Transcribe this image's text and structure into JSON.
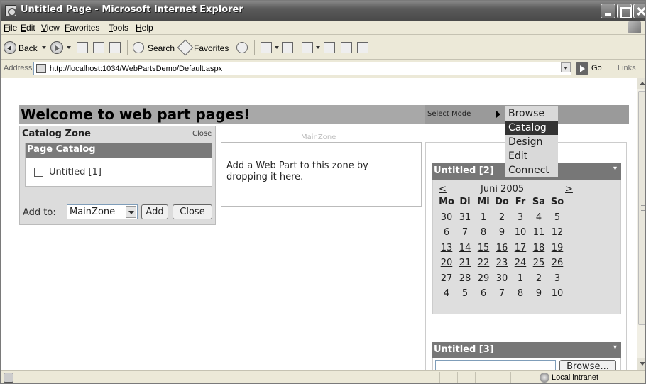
{
  "window": {
    "title": "Untitled Page - Microsoft Internet Explorer"
  },
  "menu": {
    "items": [
      "File",
      "Edit",
      "View",
      "Favorites",
      "Tools",
      "Help"
    ]
  },
  "toolbar": {
    "back_label": "Back",
    "search_label": "Search",
    "favorites_label": "Favorites"
  },
  "address": {
    "label": "Address",
    "url": "http://localhost:1034/WebPartsDemo/Default.aspx",
    "go_label": "Go",
    "links_label": "Links"
  },
  "page": {
    "heading": "Welcome to web part pages!",
    "mode": {
      "label": "Select Mode",
      "items": [
        "Browse",
        "Catalog",
        "Design",
        "Edit",
        "Connect"
      ],
      "selected": "Catalog"
    },
    "catalog_zone": {
      "title": "Catalog Zone",
      "close_verb": "Close",
      "page_catalog_title": "Page Catalog",
      "item": "Untitled [1]",
      "add_to_label": "Add to:",
      "zone_select_value": "MainZone",
      "add_button": "Add",
      "close_button": "Close"
    },
    "main_zone": {
      "label": "MainZone",
      "empty_text": "Add a Web Part to this zone by dropping it here."
    },
    "webpart2": {
      "title": "Untitled [2]",
      "verb_icon": "dropdown-arrow-icon",
      "calendar": {
        "prev": "<",
        "next": ">",
        "month": "Juni 2005",
        "day_names": [
          "Mo",
          "Di",
          "Mi",
          "Do",
          "Fr",
          "Sa",
          "So"
        ],
        "weeks": [
          [
            "30",
            "31",
            "1",
            "2",
            "3",
            "4",
            "5"
          ],
          [
            "6",
            "7",
            "8",
            "9",
            "10",
            "11",
            "12"
          ],
          [
            "13",
            "14",
            "15",
            "16",
            "17",
            "18",
            "19"
          ],
          [
            "20",
            "21",
            "22",
            "23",
            "24",
            "25",
            "26"
          ],
          [
            "27",
            "28",
            "29",
            "30",
            "1",
            "2",
            "3"
          ],
          [
            "4",
            "5",
            "6",
            "7",
            "8",
            "9",
            "10"
          ]
        ]
      }
    },
    "webpart3": {
      "title": "Untitled [3]",
      "browse_button": "Browse..."
    }
  },
  "status": {
    "zone": "Local intranet"
  },
  "colors": {
    "header_bar": "#a8a8a8",
    "webpart_title": "#777777",
    "selected_mode": "#333333"
  }
}
